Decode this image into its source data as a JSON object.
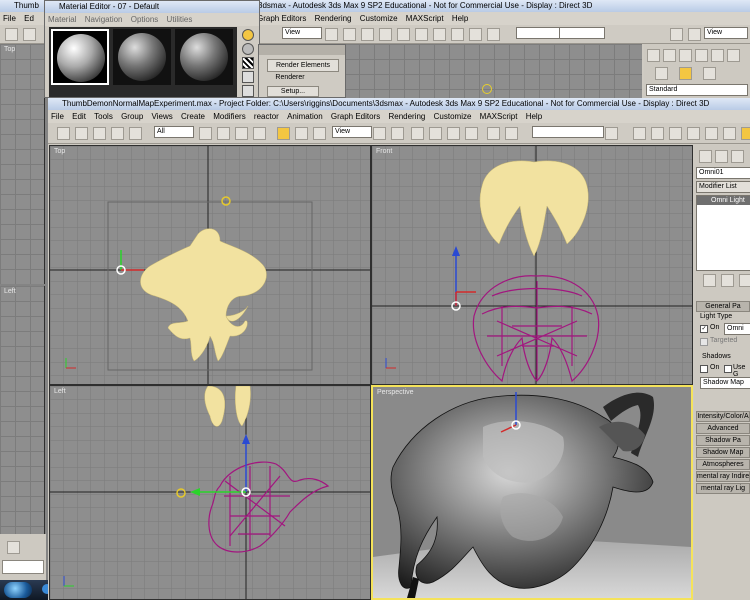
{
  "back_window": {
    "tab_title": "Thumb",
    "title": "3dsmax   -  Autodesk 3ds Max 9 SP2  Educational  - Not for Commercial Use     - Display : Direct 3D",
    "menu": [
      "Graph Editors",
      "Rendering",
      "Customize",
      "MAXScript",
      "Help"
    ],
    "left_menu": [
      "File",
      "Ed"
    ],
    "view_select": "View",
    "standard_select": "Standard",
    "view_select_right": "View",
    "viewport_top_label": "Top",
    "viewport_left_label": "Left"
  },
  "material_editor": {
    "title": "Material Editor - 07 - Default",
    "menu": [
      "Material",
      "Navigation",
      "Options",
      "Utilities"
    ]
  },
  "render_popup": {
    "items": [
      "Render Elements",
      "Renderer",
      "Setup..."
    ]
  },
  "main_window": {
    "title": "ThumbDemonNormalMapExperiment.max   - Project Folder: C:\\Users\\riggins\\Documents\\3dsmax    - Autodesk 3ds Max 9 SP2  Educational  - Not for Commercial Use     - Display : Direct 3D",
    "menu": [
      "File",
      "Edit",
      "Tools",
      "Group",
      "Views",
      "Create",
      "Modifiers",
      "reactor",
      "Animation",
      "Graph Editors",
      "Rendering",
      "Customize",
      "MAXScript",
      "Help"
    ],
    "selection_filter": "All",
    "coord_system": "View"
  },
  "viewports": {
    "top": "Top",
    "front": "Front",
    "left": "Left",
    "perspective": "Perspective"
  },
  "command_panel": {
    "object_name": "Omni01",
    "modifier_list": "Modifier List",
    "stack_item": "Omni Light",
    "general_params": "General Pa",
    "light_type_label": "Light Type",
    "on_label": "On",
    "light_type_value": "Omni",
    "targeted_label": "Targeted",
    "shadows_label": "Shadows",
    "shadows_on_label": "On",
    "use_global_label": "Use G",
    "shadow_type": "Shadow Map",
    "rollouts": [
      "Intensity/Color/A",
      "Advanced",
      "Shadow Pa",
      "Shadow Map",
      "Atmospheres",
      "mental ray Indirec",
      "mental ray Lig"
    ]
  },
  "colors": {
    "wire_yellow": "#f1e3a4",
    "wire_magenta": "#a2167f",
    "active_border": "#f5e35a",
    "viewport_bg": "#8c8c8c"
  }
}
